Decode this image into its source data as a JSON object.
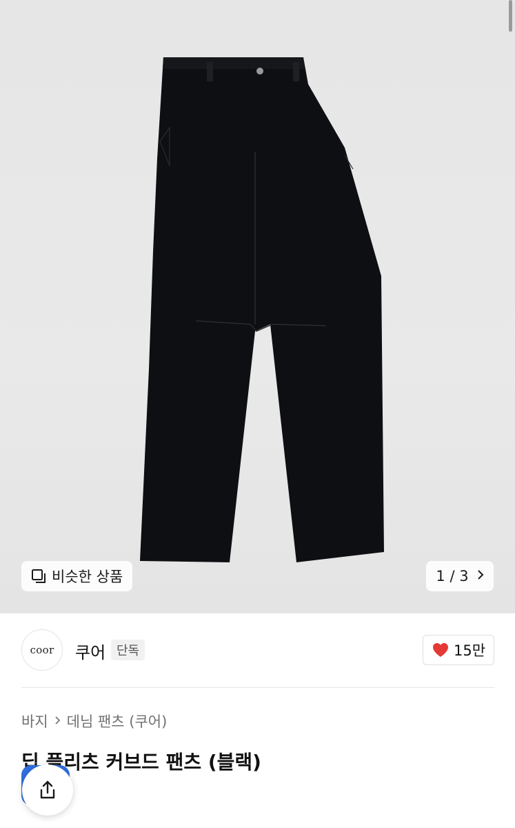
{
  "product_image": {
    "page_current": "1",
    "page_total": "3",
    "pager_text": "1 / 3"
  },
  "similar_button": {
    "label": "비슷한 상품",
    "icon": "similar-items-icon"
  },
  "brand": {
    "logo_text": "coor",
    "name": "쿠어",
    "badge": "단독"
  },
  "like": {
    "count": "15만",
    "icon": "heart-icon",
    "color": "#e53935"
  },
  "breadcrumb": {
    "category": "바지",
    "subcategory": "데님 팬츠 (쿠어)"
  },
  "product": {
    "title": "딥 플리츠 커브드 팬츠 (블랙)"
  },
  "share": {
    "icon": "share-icon"
  },
  "colors": {
    "accent_blue": "#2f6fe0",
    "heart_red": "#e53935"
  }
}
